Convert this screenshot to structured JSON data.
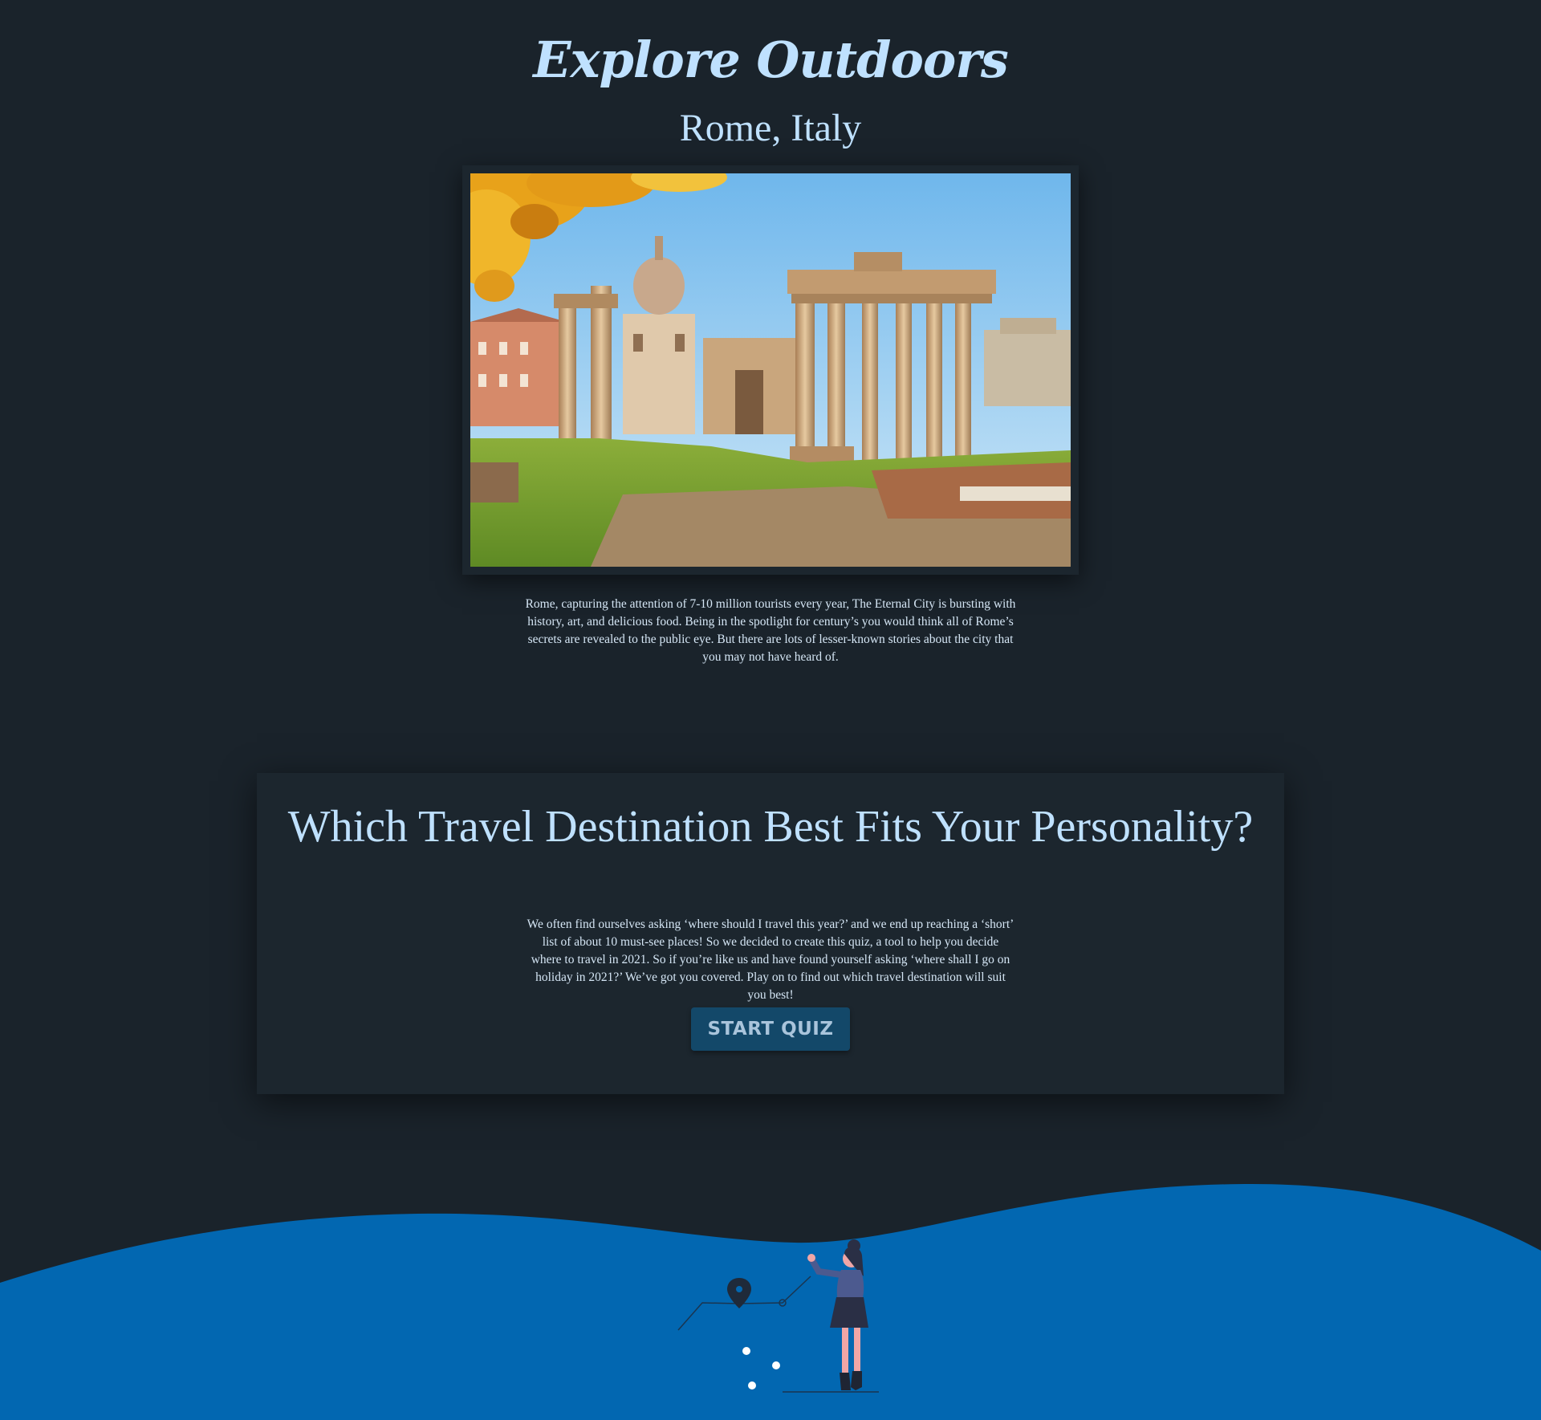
{
  "header": {
    "site_title": "Explore Outdoors",
    "city_title": "Rome, Italy"
  },
  "hero": {
    "city_description": "Rome, capturing the attention of 7-10 million tourists every year, The Eternal City is bursting with history, art, and delicious food. Being in the spotlight for century’s you would think all of Rome’s secrets are revealed to the public eye. But there are lots of lesser-known stories about the city that you may not have heard of."
  },
  "quiz": {
    "title": "Which Travel Destination Best Fits Your Personality?",
    "description": "We often find ourselves asking ‘where should I travel this year?’ and we end up reaching a ‘short’ list of about 10 must-see places! So we decided to create this quiz, a tool to help you decide where to travel in 2021. So if you’re like us and have found yourself asking ‘where shall I go on holiday in 2021?’ We’ve got you covered. Play on to find out which travel destination will suit you best!",
    "start_label": "START QUIZ"
  },
  "colors": {
    "background": "#1a232b",
    "card": "#1c262e",
    "heading": "#bfe1ff",
    "body_text": "#d5e6f5",
    "button_bg": "#134869",
    "button_text": "#a9c4db",
    "wave": "#0267b1"
  }
}
